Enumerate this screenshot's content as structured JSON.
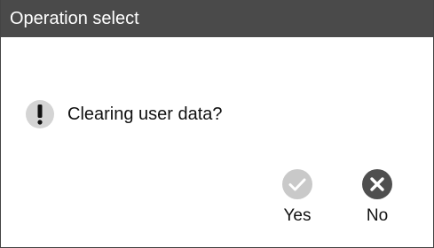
{
  "dialog": {
    "title": "Operation select",
    "message": "Clearing user data?",
    "message_icon": "exclamation-icon"
  },
  "actions": {
    "yes": {
      "label": "Yes",
      "icon": "check-icon",
      "color": "#c9c9c9"
    },
    "no": {
      "label": "No",
      "icon": "close-icon",
      "color": "#4f4f4f"
    }
  },
  "colors": {
    "titlebar_bg": "#4a4a4a",
    "title_text": "#ffffff",
    "warning_icon_bg": "#d4d4d4"
  }
}
